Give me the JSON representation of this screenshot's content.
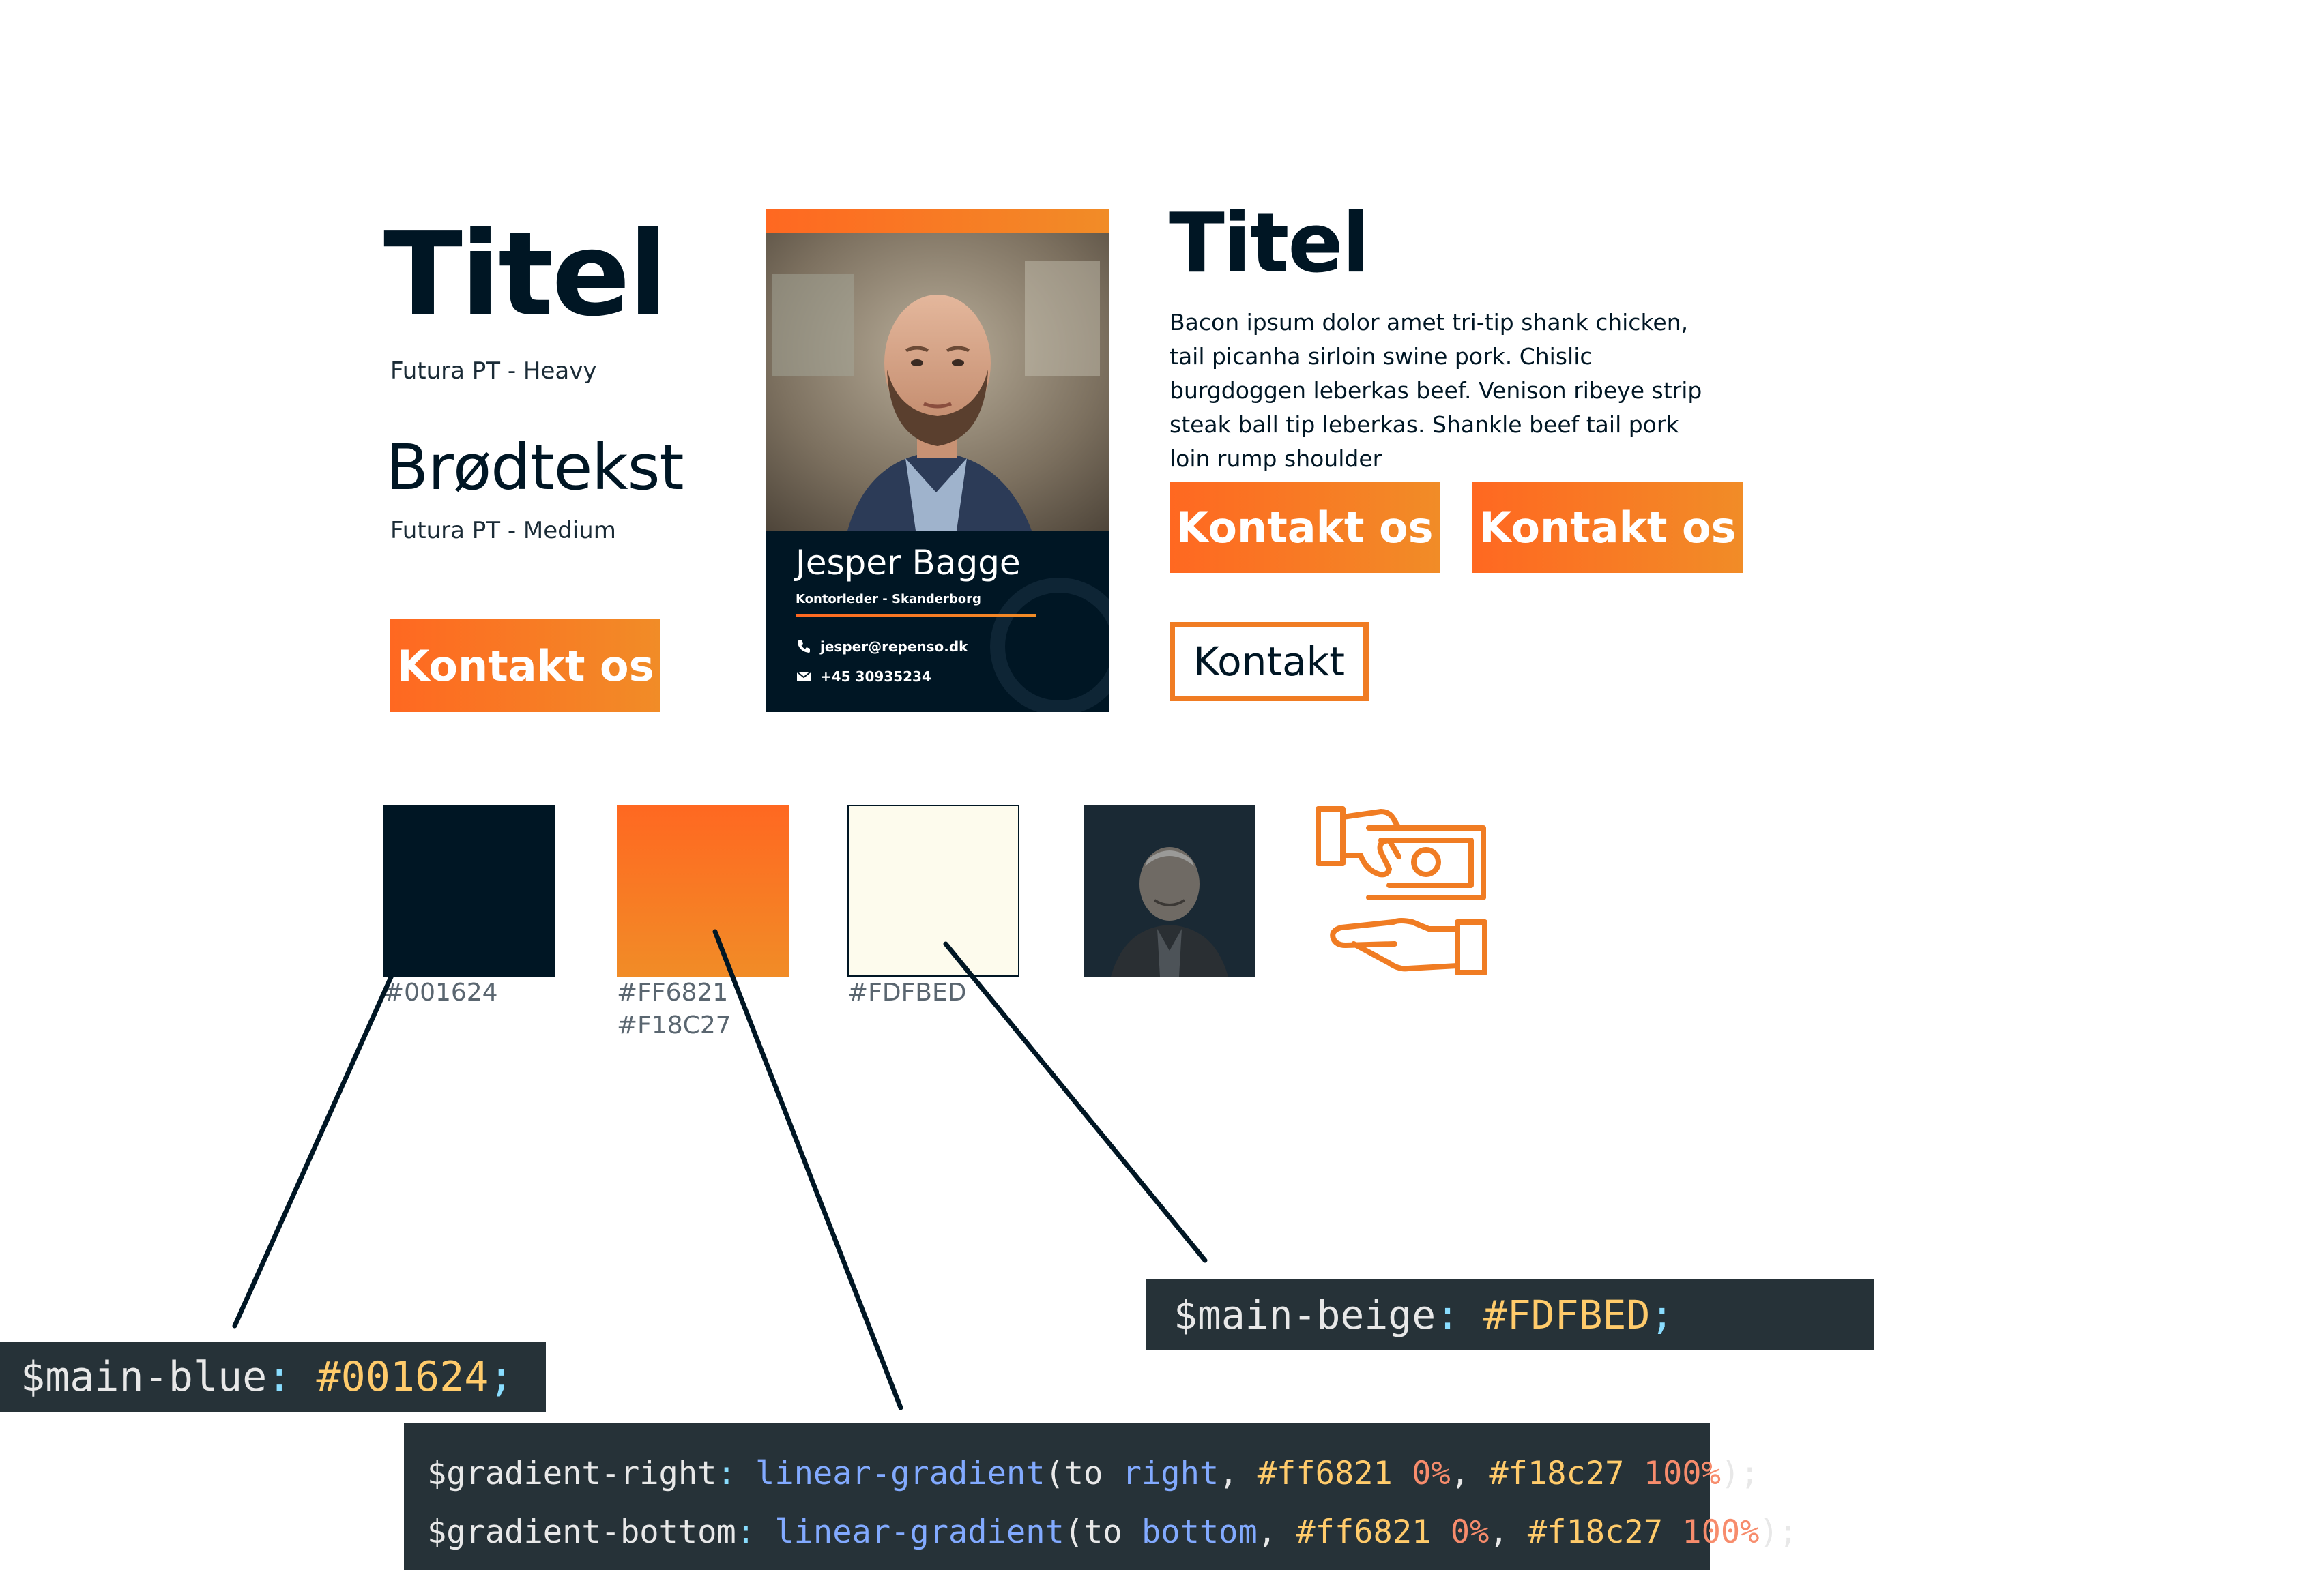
{
  "typography": {
    "heading_sample": "Titel",
    "heading_font": "Futura PT - Heavy",
    "body_sample": "Brødtekst",
    "body_font": "Futura PT - Medium"
  },
  "buttons": {
    "left_primary": "Kontakt os",
    "right_primary_1": "Kontakt os",
    "right_primary_2": "Kontakt os",
    "outline": "Kontakt"
  },
  "profile_card": {
    "name": "Jesper Bagge",
    "role": "Kontorleder - Skanderborg",
    "email": "jesper@repenso.dk",
    "phone": "+45 30935234",
    "icons": [
      "phone-icon",
      "envelope-icon"
    ]
  },
  "content_block": {
    "title": "Titel",
    "body": "Bacon ipsum dolor amet tri-tip shank chicken, tail picanha sirloin swine pork. Chislic burgdoggen leberkas beef. Venison ribeye strip steak ball tip leberkas. Shankle beef tail pork loin rump shoulder"
  },
  "palette": {
    "blue": {
      "hex": "#001624",
      "label": "#001624"
    },
    "orange": {
      "from": "#FF6821",
      "to": "#F18C27",
      "label_1": "#FF6821",
      "label_2": "#F18C27"
    },
    "beige": {
      "hex": "#FDFBED",
      "label": "#FDFBED"
    },
    "image_overlay_color": "#001624",
    "icon": "money-hand-icon"
  },
  "code": {
    "main_blue_var": "$main-blue",
    "main_blue_colon": ":",
    "main_blue_value": "#001624",
    "main_blue_semi": ";",
    "main_beige_var": "$main-beige",
    "main_beige_colon": ":",
    "main_beige_value": "#FDFBED",
    "main_beige_semi": ";",
    "gradients": [
      {
        "var": "$gradient-right",
        "colon": ":",
        "fn": "linear-gradient",
        "open": "(to ",
        "dir": "right",
        "comma1": ", ",
        "c1": "#ff6821",
        "p1": "0%",
        "comma2": ", ",
        "c2": "#f18c27",
        "p2": "100%",
        "close": ");"
      },
      {
        "var": "$gradient-bottom",
        "colon": ":",
        "fn": "linear-gradient",
        "open": "(to ",
        "dir": "bottom",
        "comma1": ", ",
        "c1": "#ff6821",
        "p1": "0%",
        "comma2": ", ",
        "c2": "#f18c27",
        "p2": "100%",
        "close": ");"
      }
    ]
  },
  "colors": {
    "navy": "#001624",
    "orange_start": "#ff6821",
    "orange_end": "#f18c27",
    "beige": "#FDFBED",
    "code_bg": "#263238"
  }
}
